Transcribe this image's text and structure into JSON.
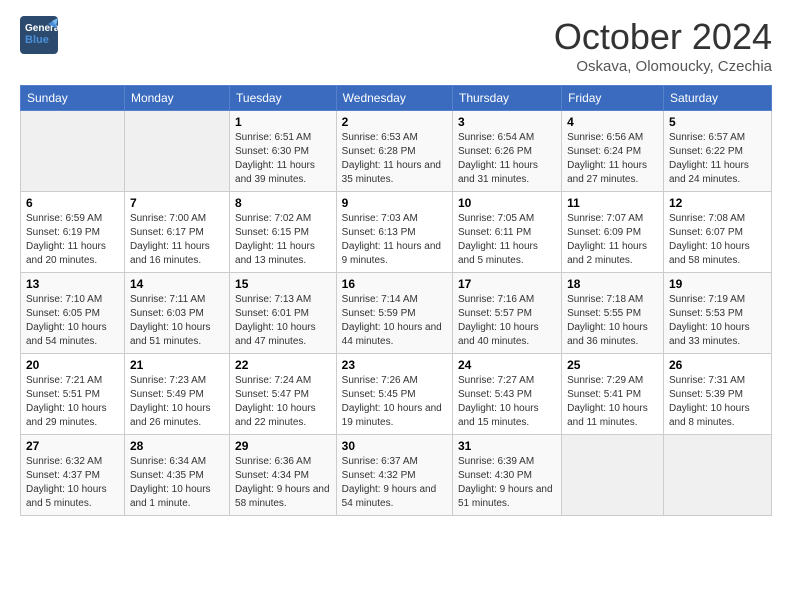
{
  "header": {
    "logo_line1": "General",
    "logo_line2": "Blue",
    "month": "October 2024",
    "location": "Oskava, Olomoucky, Czechia"
  },
  "days_of_week": [
    "Sunday",
    "Monday",
    "Tuesday",
    "Wednesday",
    "Thursday",
    "Friday",
    "Saturday"
  ],
  "weeks": [
    [
      {
        "day": "",
        "info": ""
      },
      {
        "day": "",
        "info": ""
      },
      {
        "day": "1",
        "info": "Sunrise: 6:51 AM\nSunset: 6:30 PM\nDaylight: 11 hours and 39 minutes."
      },
      {
        "day": "2",
        "info": "Sunrise: 6:53 AM\nSunset: 6:28 PM\nDaylight: 11 hours and 35 minutes."
      },
      {
        "day": "3",
        "info": "Sunrise: 6:54 AM\nSunset: 6:26 PM\nDaylight: 11 hours and 31 minutes."
      },
      {
        "day": "4",
        "info": "Sunrise: 6:56 AM\nSunset: 6:24 PM\nDaylight: 11 hours and 27 minutes."
      },
      {
        "day": "5",
        "info": "Sunrise: 6:57 AM\nSunset: 6:22 PM\nDaylight: 11 hours and 24 minutes."
      }
    ],
    [
      {
        "day": "6",
        "info": "Sunrise: 6:59 AM\nSunset: 6:19 PM\nDaylight: 11 hours and 20 minutes."
      },
      {
        "day": "7",
        "info": "Sunrise: 7:00 AM\nSunset: 6:17 PM\nDaylight: 11 hours and 16 minutes."
      },
      {
        "day": "8",
        "info": "Sunrise: 7:02 AM\nSunset: 6:15 PM\nDaylight: 11 hours and 13 minutes."
      },
      {
        "day": "9",
        "info": "Sunrise: 7:03 AM\nSunset: 6:13 PM\nDaylight: 11 hours and 9 minutes."
      },
      {
        "day": "10",
        "info": "Sunrise: 7:05 AM\nSunset: 6:11 PM\nDaylight: 11 hours and 5 minutes."
      },
      {
        "day": "11",
        "info": "Sunrise: 7:07 AM\nSunset: 6:09 PM\nDaylight: 11 hours and 2 minutes."
      },
      {
        "day": "12",
        "info": "Sunrise: 7:08 AM\nSunset: 6:07 PM\nDaylight: 10 hours and 58 minutes."
      }
    ],
    [
      {
        "day": "13",
        "info": "Sunrise: 7:10 AM\nSunset: 6:05 PM\nDaylight: 10 hours and 54 minutes."
      },
      {
        "day": "14",
        "info": "Sunrise: 7:11 AM\nSunset: 6:03 PM\nDaylight: 10 hours and 51 minutes."
      },
      {
        "day": "15",
        "info": "Sunrise: 7:13 AM\nSunset: 6:01 PM\nDaylight: 10 hours and 47 minutes."
      },
      {
        "day": "16",
        "info": "Sunrise: 7:14 AM\nSunset: 5:59 PM\nDaylight: 10 hours and 44 minutes."
      },
      {
        "day": "17",
        "info": "Sunrise: 7:16 AM\nSunset: 5:57 PM\nDaylight: 10 hours and 40 minutes."
      },
      {
        "day": "18",
        "info": "Sunrise: 7:18 AM\nSunset: 5:55 PM\nDaylight: 10 hours and 36 minutes."
      },
      {
        "day": "19",
        "info": "Sunrise: 7:19 AM\nSunset: 5:53 PM\nDaylight: 10 hours and 33 minutes."
      }
    ],
    [
      {
        "day": "20",
        "info": "Sunrise: 7:21 AM\nSunset: 5:51 PM\nDaylight: 10 hours and 29 minutes."
      },
      {
        "day": "21",
        "info": "Sunrise: 7:23 AM\nSunset: 5:49 PM\nDaylight: 10 hours and 26 minutes."
      },
      {
        "day": "22",
        "info": "Sunrise: 7:24 AM\nSunset: 5:47 PM\nDaylight: 10 hours and 22 minutes."
      },
      {
        "day": "23",
        "info": "Sunrise: 7:26 AM\nSunset: 5:45 PM\nDaylight: 10 hours and 19 minutes."
      },
      {
        "day": "24",
        "info": "Sunrise: 7:27 AM\nSunset: 5:43 PM\nDaylight: 10 hours and 15 minutes."
      },
      {
        "day": "25",
        "info": "Sunrise: 7:29 AM\nSunset: 5:41 PM\nDaylight: 10 hours and 11 minutes."
      },
      {
        "day": "26",
        "info": "Sunrise: 7:31 AM\nSunset: 5:39 PM\nDaylight: 10 hours and 8 minutes."
      }
    ],
    [
      {
        "day": "27",
        "info": "Sunrise: 6:32 AM\nSunset: 4:37 PM\nDaylight: 10 hours and 5 minutes."
      },
      {
        "day": "28",
        "info": "Sunrise: 6:34 AM\nSunset: 4:35 PM\nDaylight: 10 hours and 1 minute."
      },
      {
        "day": "29",
        "info": "Sunrise: 6:36 AM\nSunset: 4:34 PM\nDaylight: 9 hours and 58 minutes."
      },
      {
        "day": "30",
        "info": "Sunrise: 6:37 AM\nSunset: 4:32 PM\nDaylight: 9 hours and 54 minutes."
      },
      {
        "day": "31",
        "info": "Sunrise: 6:39 AM\nSunset: 4:30 PM\nDaylight: 9 hours and 51 minutes."
      },
      {
        "day": "",
        "info": ""
      },
      {
        "day": "",
        "info": ""
      }
    ]
  ]
}
